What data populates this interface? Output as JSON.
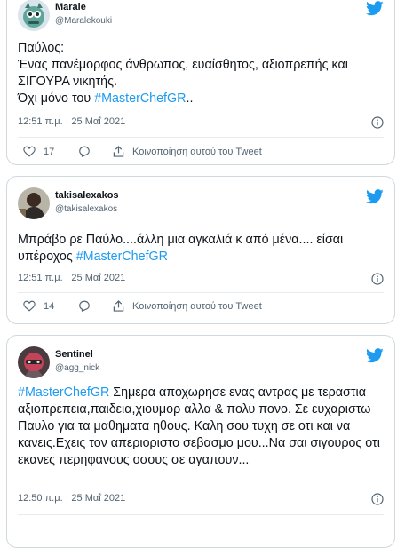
{
  "colors": {
    "accent": "#1d9bf0",
    "text": "#0f1419",
    "muted": "#536471",
    "border": "#cfd9de"
  },
  "tweets": [
    {
      "name": "Marale",
      "handle": "@Maralekouki",
      "avatar_icon": "avatar-mascot",
      "text_before": "Παύλος:\nΈνας πανέμορφος άνθρωπος, ευαίσθητος, αξιοπρεπής και ΣΙΓΟΥΡΑ νικητής.\nΌχι μόνο του ",
      "hashtag": "#MasterChefGR",
      "text_after": "..",
      "timestamp": "12:51 π.μ. · 25 Μαΐ 2021",
      "likes": "17",
      "share_label": "Κοινοποίηση αυτού του Tweet"
    },
    {
      "name": "takisalexakos",
      "handle": "@takisalexakos",
      "avatar_icon": "avatar-photo",
      "text_before": "Μπράβο ρε Παύλο....άλλη μια αγκαλιά κ από μένα.... είσαι υπέροχος ",
      "hashtag": "#MasterChefGR",
      "text_after": "",
      "timestamp": "12:51 π.μ. · 25 Μαΐ 2021",
      "likes": "14",
      "share_label": "Κοινοποίηση αυτού του Tweet"
    },
    {
      "name": "Sentinel",
      "handle": "@agg_nick",
      "avatar_icon": "avatar-photo",
      "hashtag": "#MasterChefGR",
      "text_after": " Σημερα αποχωρησε ενας αντρας με τεραστια αξιοπρεπεια,παιδεια,χιουμορ αλλα & πολυ πονο. Σε ευχαριστω Παυλο για τα μαθηματα ηθους. Καλη σου τυχη σε οτι και να κανεις.Εχεις τον απεριοριστο σεβασμο μου...Να σαι σιγουρος οτι εκανες περηφανους οσους σε αγαπουν...",
      "timestamp": "12:50 π.μ. · 25 Μαΐ 2021"
    }
  ]
}
